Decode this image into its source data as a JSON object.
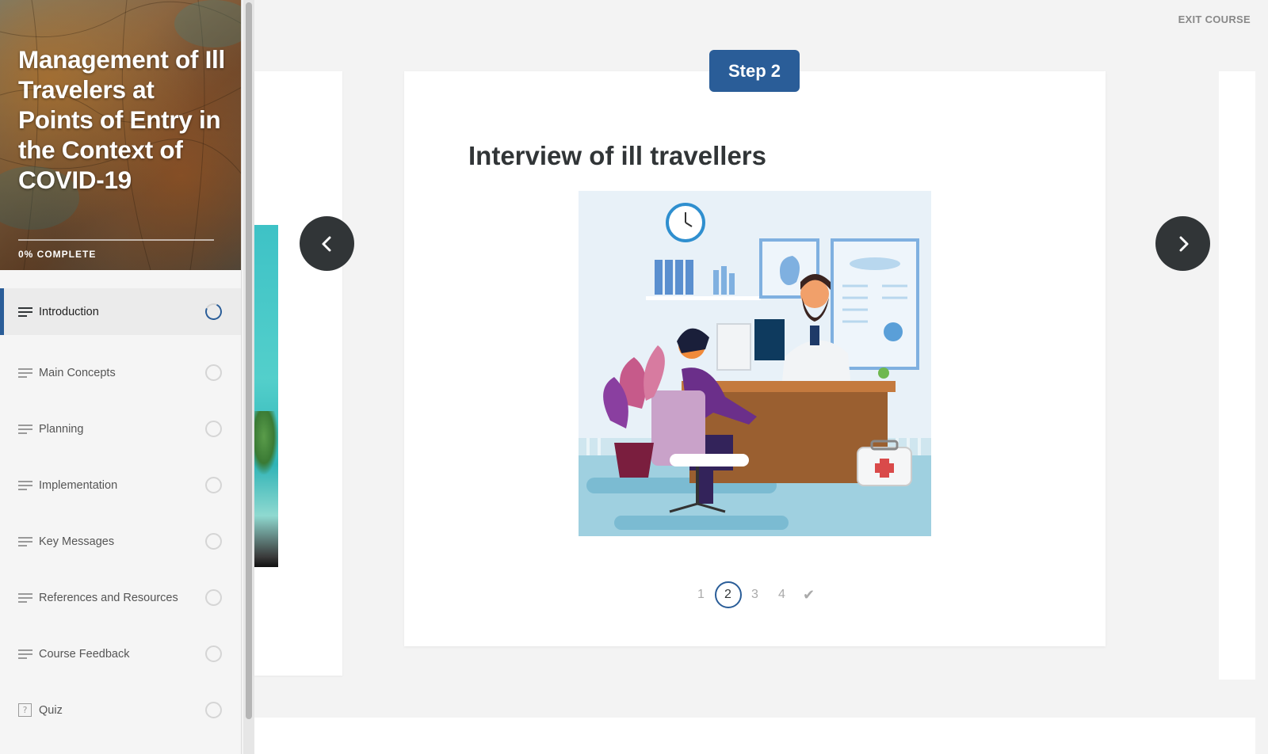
{
  "course": {
    "title": "Management of Ill Travelers at Points of Entry in the Context of COVID-19",
    "progress_text": "0% COMPLETE"
  },
  "sidebar": {
    "items": [
      {
        "label": "Introduction",
        "icon": "lines-icon",
        "status": "in-progress",
        "active": true
      },
      {
        "label": "Main Concepts",
        "icon": "lines-icon",
        "status": "not-started"
      },
      {
        "label": "Planning",
        "icon": "lines-icon",
        "status": "not-started"
      },
      {
        "label": "Implementation",
        "icon": "lines-icon",
        "status": "not-started"
      },
      {
        "label": "Key Messages",
        "icon": "lines-icon",
        "status": "not-started"
      },
      {
        "label": "References and Resources",
        "icon": "lines-icon",
        "status": "not-started"
      },
      {
        "label": "Course Feedback",
        "icon": "lines-icon",
        "status": "not-started"
      },
      {
        "label": "Quiz",
        "icon": "quiz-icon",
        "status": "not-started"
      }
    ]
  },
  "header": {
    "exit_label": "EXIT COURSE"
  },
  "step": {
    "badge": "Step 2",
    "title": "Interview of ill travellers",
    "pages": [
      "1",
      "2",
      "3",
      "4"
    ],
    "current_page": "2"
  },
  "colors": {
    "accent": "#2a5d98",
    "dark_button": "#313537",
    "background": "#f3f3f3"
  }
}
